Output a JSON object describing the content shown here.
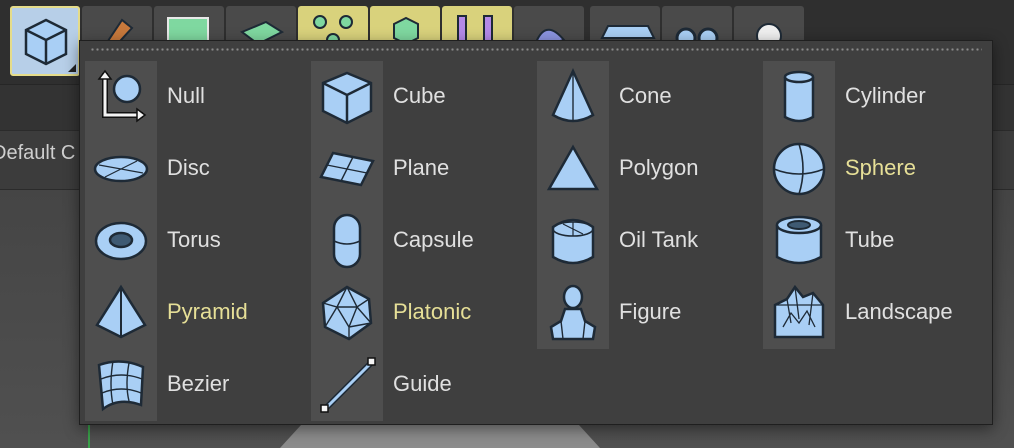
{
  "background": {
    "partial_label": "Default C"
  },
  "menu": {
    "columns": [
      [
        {
          "name": "Null",
          "icon": "null-icon",
          "highlight": false
        },
        {
          "name": "Disc",
          "icon": "disc-icon",
          "highlight": false
        },
        {
          "name": "Torus",
          "icon": "torus-icon",
          "highlight": false
        },
        {
          "name": "Pyramid",
          "icon": "pyramid-icon",
          "highlight": true
        },
        {
          "name": "Bezier",
          "icon": "bezier-icon",
          "highlight": false
        }
      ],
      [
        {
          "name": "Cube",
          "icon": "cube-icon",
          "highlight": false
        },
        {
          "name": "Plane",
          "icon": "plane-icon",
          "highlight": false
        },
        {
          "name": "Capsule",
          "icon": "capsule-icon",
          "highlight": false
        },
        {
          "name": "Platonic",
          "icon": "platonic-icon",
          "highlight": true
        },
        {
          "name": "Guide",
          "icon": "guide-icon",
          "highlight": false
        }
      ],
      [
        {
          "name": "Cone",
          "icon": "cone-icon",
          "highlight": false
        },
        {
          "name": "Polygon",
          "icon": "polygon-icon",
          "highlight": false
        },
        {
          "name": "Oil Tank",
          "icon": "oil-tank-icon",
          "highlight": false
        },
        {
          "name": "Figure",
          "icon": "figure-icon",
          "highlight": false
        }
      ],
      [
        {
          "name": "Cylinder",
          "icon": "cylinder-icon",
          "highlight": false
        },
        {
          "name": "Sphere",
          "icon": "sphere-icon",
          "highlight": true
        },
        {
          "name": "Tube",
          "icon": "tube-icon",
          "highlight": false
        },
        {
          "name": "Landscape",
          "icon": "landscape-icon",
          "highlight": false
        }
      ]
    ]
  },
  "colors": {
    "popup_bg": "#3f3f3f",
    "icon_cell_bg": "#4e4e4e",
    "label": "#e0e0e0",
    "label_highlight": "#e6df97",
    "icon_fill": "#a9cff5",
    "icon_stroke": "#1e2a36"
  }
}
